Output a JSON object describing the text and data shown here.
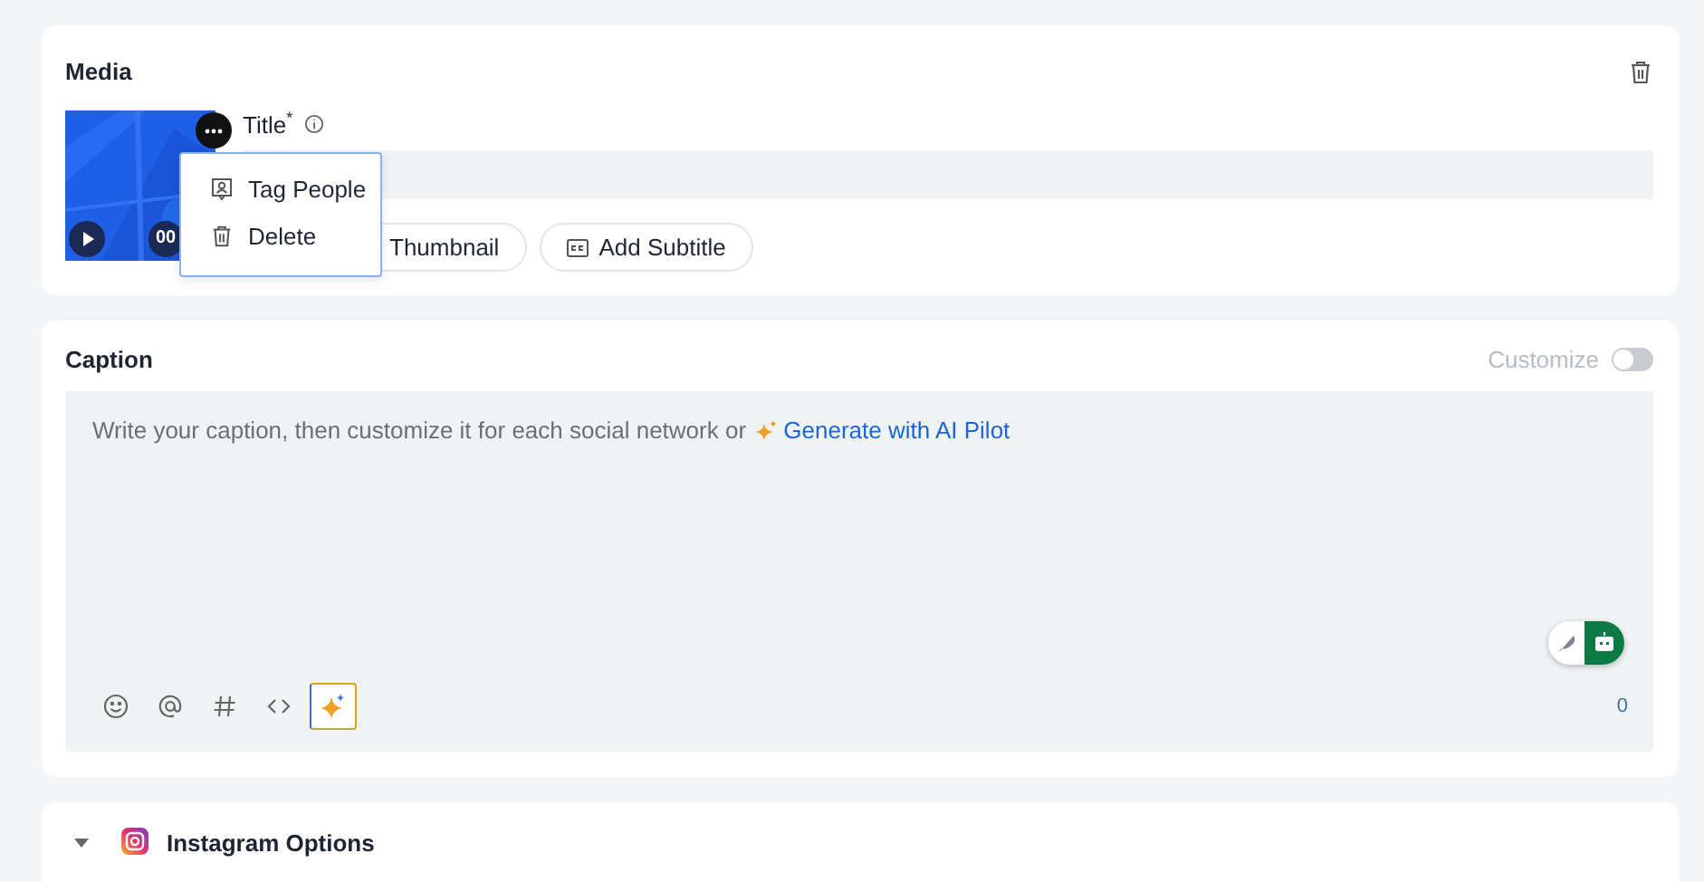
{
  "media": {
    "title": "Media",
    "thumbnail": {
      "kind": "picture",
      "duration": "00"
    },
    "menu": {
      "items": [
        {
          "label": "Tag People"
        },
        {
          "label": "Delete"
        }
      ]
    },
    "title_field": {
      "label": "Title",
      "required_mark": "*"
    },
    "buttons": [
      {
        "label": "Thumbnail"
      },
      {
        "label": "Add Subtitle"
      }
    ]
  },
  "caption": {
    "title": "Caption",
    "customize": {
      "label": "Customize",
      "on": false
    },
    "placeholder": "Write your caption, then customize it for each social network or ",
    "ai_link": "Generate with AI Pilot",
    "toolbar": [
      {
        "selected": false
      },
      {
        "selected": false
      },
      {
        "selected": false
      },
      {
        "selected": false
      },
      {
        "selected": true
      }
    ],
    "counter": "0",
    "assistant": {
      "on": true
    }
  },
  "instagram": {
    "title": "Instagram Options"
  }
}
